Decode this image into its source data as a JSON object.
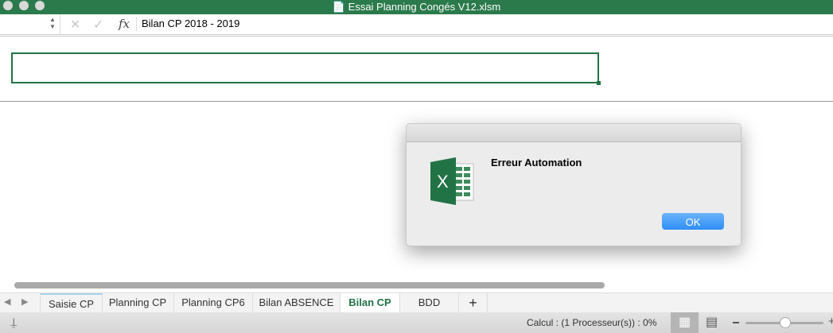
{
  "window": {
    "title": "Essai Planning Congés V12.xlsm"
  },
  "formula_bar": {
    "fx": "fx",
    "value": "Bilan CP 2018 - 2019"
  },
  "dialog": {
    "message": "Erreur Automation",
    "ok_label": "OK",
    "icon": "excel-icon"
  },
  "sheet_tabs": [
    {
      "label": "Saisie CP"
    },
    {
      "label": "Planning CP"
    },
    {
      "label": "Planning CP6"
    },
    {
      "label": "Bilan ABSENCE"
    },
    {
      "label": "Bilan CP",
      "active": true
    },
    {
      "label": "BDD"
    }
  ],
  "add_sheet": "+",
  "status": {
    "calc": "Calcul : (1 Processeur(s)) : 0%"
  },
  "colors": {
    "accent": "#217346",
    "ok": "#2e8ef5"
  }
}
